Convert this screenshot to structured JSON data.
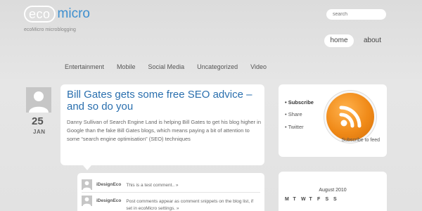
{
  "site": {
    "logo_eco": "eco",
    "logo_micro": "micro",
    "tagline": "ecoMicro microblogging"
  },
  "search": {
    "placeholder": "search"
  },
  "nav": {
    "home": "home",
    "about": "about"
  },
  "categories": [
    "Entertainment",
    "Mobile",
    "Social Media",
    "Uncategorized",
    "Video"
  ],
  "post": {
    "day": "25",
    "month": "JAN",
    "title": "Bill Gates gets some free SEO advice – and so do you",
    "excerpt": "Danny Sullivan of Search Engine Land is helping Bill Gates to get his blog higher in Google than the fake Bill Gates blogs, which means paying a bit of attention to some “search engine optimisation” (SEO) techniques"
  },
  "comments": [
    {
      "author": "iDesignEco",
      "text": "This is a test comment.. »"
    },
    {
      "author": "iDesignEco",
      "text": "Post comments appear as comment snippets on the blog list, if set in ecoMicro settings. »"
    }
  ],
  "share": {
    "items": [
      "• Subscribe",
      "• Share",
      "• Twitter"
    ],
    "feed_label": "Subscribe to feed"
  },
  "calendar": {
    "title": "August 2010",
    "days": [
      "M",
      "T",
      "W",
      "T",
      "F",
      "S",
      "S"
    ]
  },
  "colors": {
    "brand_blue": "#3d8fcf",
    "rss_orange": "#f08a18",
    "background": "#e2e2e2"
  }
}
